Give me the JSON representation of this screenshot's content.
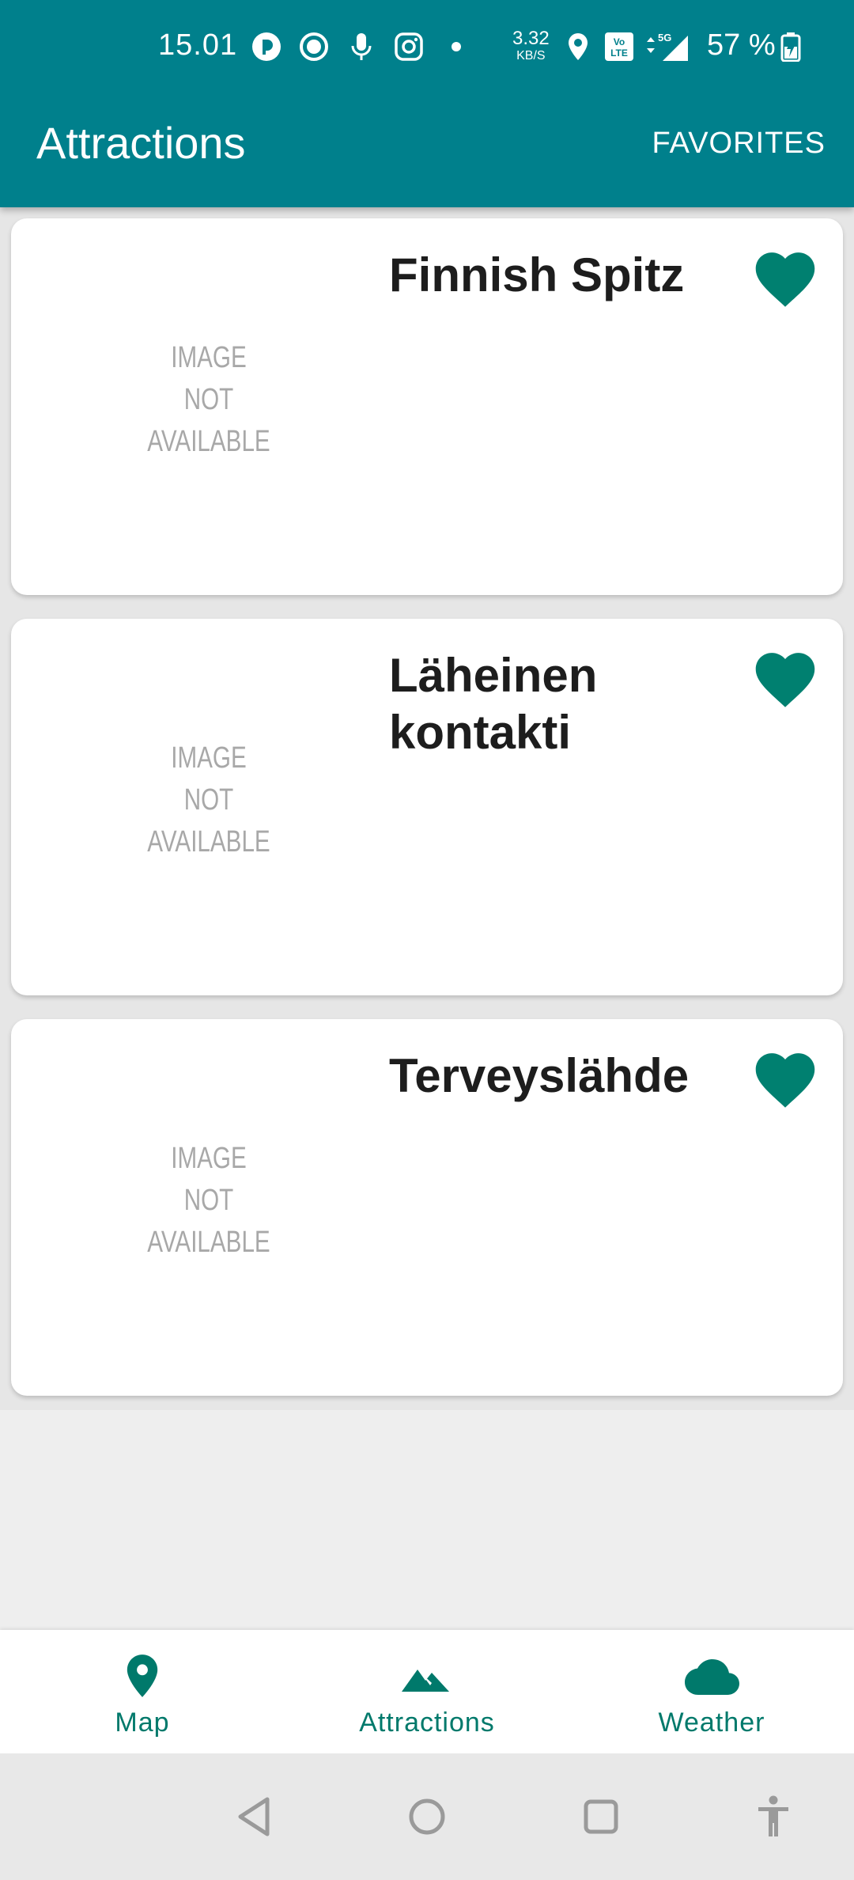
{
  "status_bar": {
    "time": "15.01",
    "net_speed": "3.32",
    "net_speed_unit": "KB/S",
    "network": "5G",
    "battery": "57 %"
  },
  "app_bar": {
    "title": "Attractions",
    "favorites_label": "FAVORITES"
  },
  "attractions": [
    {
      "title": "Finnish Spitz",
      "image_placeholder": [
        "IMAGE",
        "NOT",
        "AVAILABLE"
      ],
      "favorite": true
    },
    {
      "title": "Läheinen kontakti",
      "image_placeholder": [
        "IMAGE",
        "NOT",
        "AVAILABLE"
      ],
      "favorite": true
    },
    {
      "title": "Terveyslähde",
      "image_placeholder": [
        "IMAGE",
        "NOT",
        "AVAILABLE"
      ],
      "favorite": true
    }
  ],
  "bottom_nav": [
    {
      "label": "Map",
      "icon": "location-pin-icon"
    },
    {
      "label": "Attractions",
      "icon": "mountain-icon"
    },
    {
      "label": "Weather",
      "icon": "cloud-icon"
    }
  ],
  "colors": {
    "primary": "#00808c",
    "accent": "#00796b",
    "heart": "#008070"
  }
}
